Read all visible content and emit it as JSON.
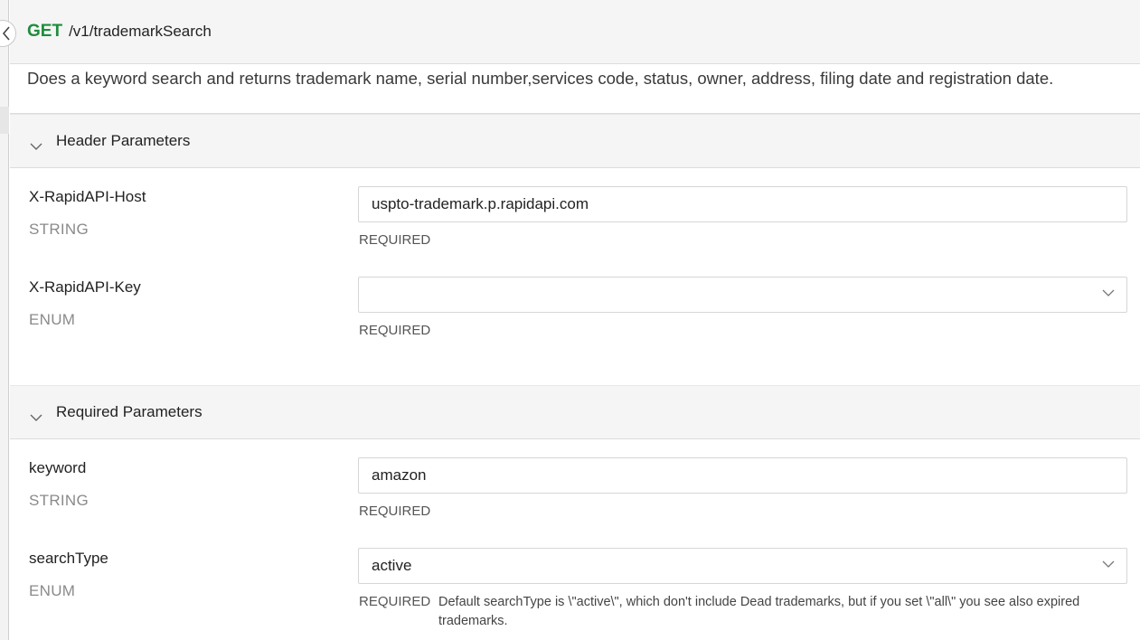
{
  "endpoint": {
    "method": "GET",
    "path": "/v1/trademarkSearch",
    "description": "Does a keyword search and returns trademark name, serial number,services code, status, owner, address, filing date and registration date."
  },
  "header_params": {
    "title": "Header Parameters",
    "params": [
      {
        "name": "X-RapidAPI-Host",
        "type": "STRING",
        "value": "uspto-trademark.p.rapidapi.com",
        "required": "REQUIRED"
      },
      {
        "name": "X-RapidAPI-Key",
        "type": "ENUM",
        "value": "",
        "required": "REQUIRED"
      }
    ]
  },
  "required_params": {
    "title": "Required Parameters",
    "params": [
      {
        "name": "keyword",
        "type": "STRING",
        "value": "amazon",
        "required": "REQUIRED"
      },
      {
        "name": "searchType",
        "type": "ENUM",
        "value": "active",
        "required": "REQUIRED",
        "hint": "Default searchType is \\\"active\\\", which don't include Dead trademarks, but if you set \\\"all\\\" you see also expired trademarks."
      }
    ]
  },
  "icons": {
    "collapse": "chevron-left-icon",
    "section_toggle": "chevron-down-icon",
    "select_toggle": "chevron-down-icon"
  },
  "colors": {
    "method_get": "#1f8c3b",
    "section_bg": "#f5f5f5",
    "muted_text": "#8a8a8a"
  }
}
